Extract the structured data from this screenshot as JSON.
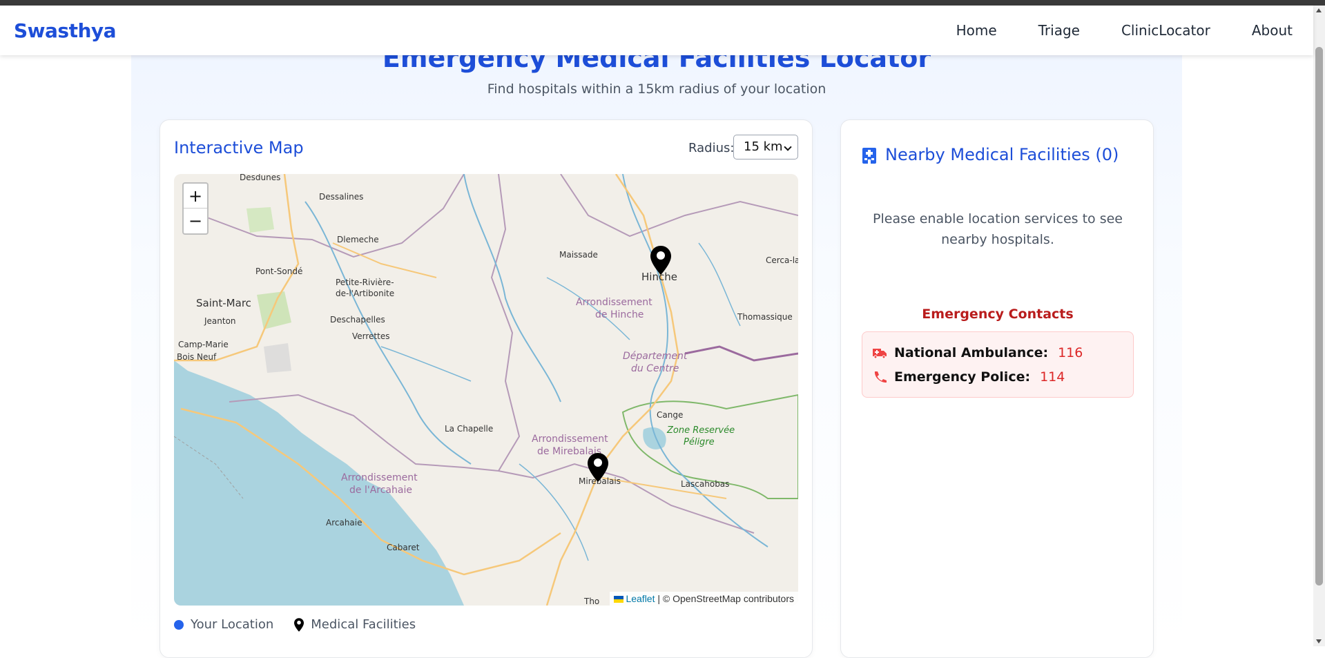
{
  "nav": {
    "brand": "Swasthya",
    "links": [
      "Home",
      "Triage",
      "ClinicLocator",
      "About"
    ]
  },
  "page": {
    "title": "Emergency Medical Facilities Locator",
    "subtitle": "Find hospitals within a 15km radius of your location"
  },
  "map_card": {
    "title": "Interactive Map",
    "radius_label": "Radius:",
    "radius_value": "15 km",
    "zoom_in": "+",
    "zoom_out": "−",
    "attribution_leaflet": "Leaflet",
    "attribution_osm": "| © OpenStreetMap contributors",
    "legend_location": "Your Location",
    "legend_facilities": "Medical Facilities",
    "labels": {
      "dessalines": "Dessalines",
      "desdunes": "Desdunes",
      "dlemeche": "Dlemeche",
      "pont_sonde": "Pont-Sondé",
      "petite_riviere_1": "Petite-Rivière-",
      "petite_riviere_2": "de-l'Artibonite",
      "saint_marc": "Saint-Marc",
      "jeanton": "Jeanton",
      "deschapelles": "Deschapelles",
      "verrettes": "Verrettes",
      "camp_marie": "Camp-Marie",
      "bois_neuf": "Bois Neuf",
      "maissade": "Maissade",
      "hinche": "Hinche",
      "cerca": "Cerca-la",
      "arr_hinche_1": "Arrondissement",
      "arr_hinche_2": "de Hinche",
      "thomassique": "Thomassique",
      "dept_1": "Département",
      "dept_2": "du Centre",
      "cange": "Cange",
      "zone_1": "Zone Reservée",
      "zone_2": "Péligre",
      "la_chapelle": "La Chapelle",
      "arr_mire_1": "Arrondissement",
      "arr_mire_2": "de Mirebalais",
      "mirebalais": "Mirebalais",
      "lascahobas": "Lascahobas",
      "arr_arcahaie_1": "Arrondissement",
      "arr_arcahaie_2": "de l'Arcahaie",
      "arcahaie": "Arcahaie",
      "cabaret": "Cabaret",
      "tho": "Tho"
    }
  },
  "side_card": {
    "title": "Nearby Medical Facilities (0)",
    "message": "Please enable location services to see nearby hospitals.",
    "emergency_title": "Emergency Contacts",
    "contacts": [
      {
        "label": "National Ambulance:",
        "number": "116",
        "icon": "ambulance-icon"
      },
      {
        "label": "Emergency Police:",
        "number": "114",
        "icon": "phone-icon"
      }
    ]
  },
  "colors": {
    "brand": "#1d4ed8",
    "emergency": "#dc2626",
    "water": "#aad3df",
    "land": "#f2efe9"
  }
}
